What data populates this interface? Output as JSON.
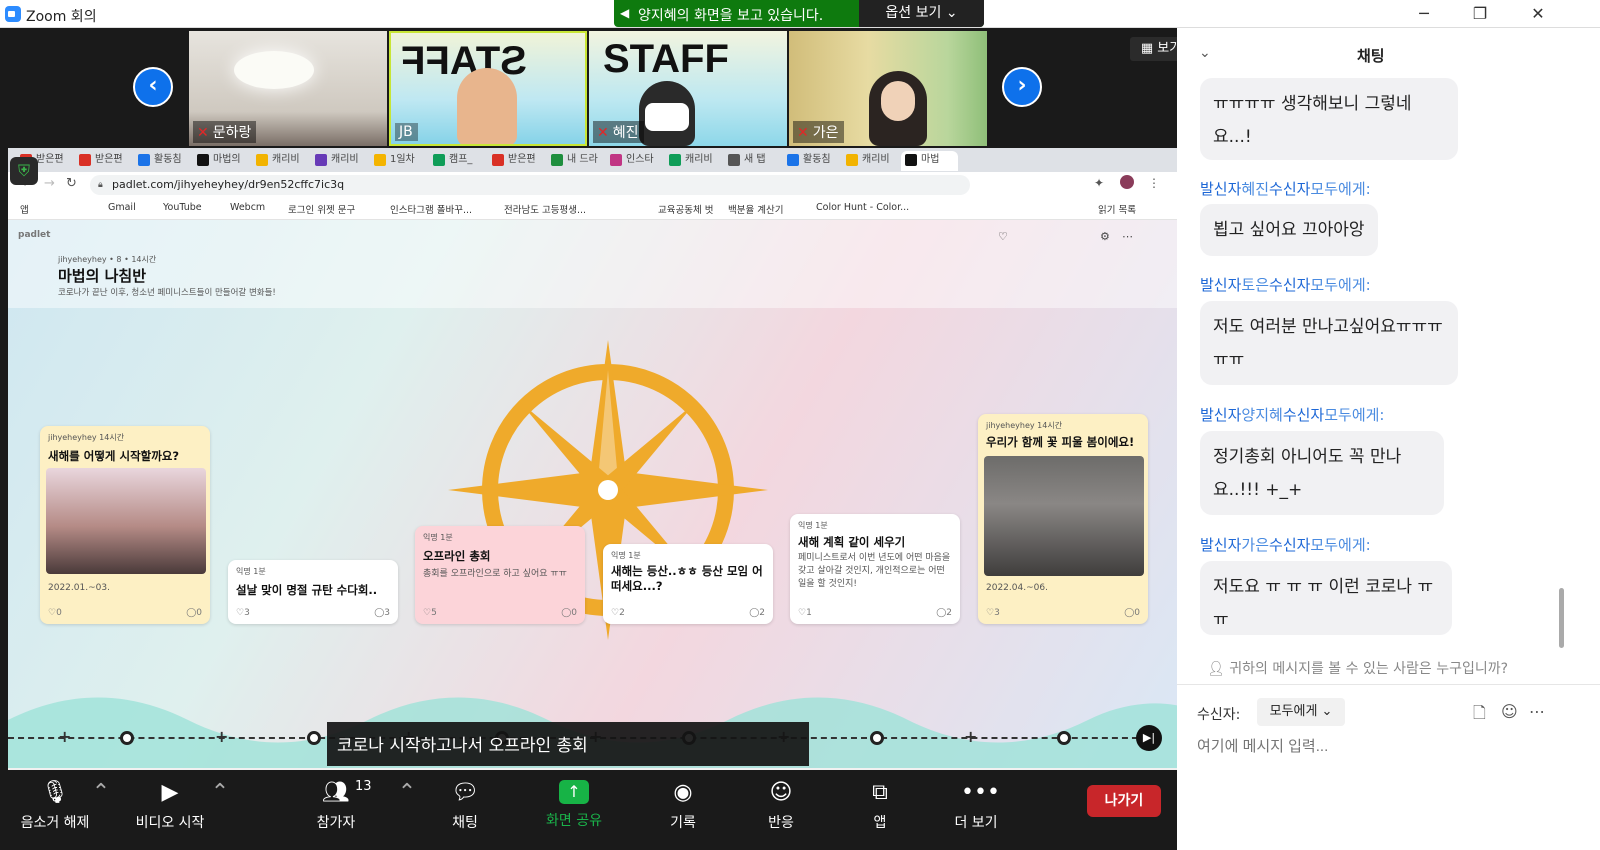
{
  "window": {
    "title": "Zoom 회의",
    "minimize": "─",
    "restore": "❐",
    "close": "✕"
  },
  "share_banner": {
    "text": "양지혜의 화면을 보고 있습니다.",
    "options": "옵션 보기 ⌄"
  },
  "view_button": "보기",
  "participants": [
    {
      "name": "문하랑",
      "muted": true
    },
    {
      "name": "JB",
      "muted": false
    },
    {
      "name": "혜진",
      "muted": true
    },
    {
      "name": "가은",
      "muted": true
    }
  ],
  "browser": {
    "tabs": [
      "받은편",
      "받은편",
      "활동침",
      "마법의",
      "캐리비",
      "캐리비",
      "1일차",
      "캠프_",
      "받은편",
      "내 드라",
      "인스타",
      "캐리비",
      "새 탭",
      "활동침",
      "캐리비",
      "마법"
    ],
    "url": "padlet.com/jihyeheyhey/dr9en52cffc7ic3q",
    "bookmarks": [
      "앱",
      "Gmail",
      "YouTube",
      "Webcm",
      "로그인 위젯 문구",
      "인스타그램 폴바꾸...",
      "전라남도 고등평생...",
      "교육공동체 벗",
      "백분율 계산기",
      "Color Hunt - Color...",
      "읽기 목록"
    ]
  },
  "padlet": {
    "brand": "padlet",
    "owner": "jihyeheyhey",
    "meta": "• 8 • 14시간",
    "title": "마법의 나침반",
    "subtitle": "코로나가 끝난 이후, 청소년 페미니스트들이 만들어갈 변화들!",
    "cards": [
      {
        "author": "jihyeheyhey",
        "time": "14시간",
        "title": "새해를 어떻게 시작할까요?",
        "body": "",
        "date": "2022.01.~03.",
        "likes": "0",
        "comments": "0"
      },
      {
        "author": "익명",
        "time": "1분",
        "title": "설날 맞이 명절 규탄 수다회..",
        "body": "",
        "date": "",
        "likes": "3",
        "comments": "3"
      },
      {
        "author": "익명",
        "time": "1분",
        "title": "오프라인 총회",
        "body": "총회를 오프라인으로 하고 싶어요 ㅠㅠ",
        "date": "",
        "likes": "5",
        "comments": "0"
      },
      {
        "author": "익명",
        "time": "1분",
        "title": "새해는 등산..ㅎㅎ 등산 모임 어떠세요...?",
        "body": "",
        "date": "",
        "likes": "2",
        "comments": "2"
      },
      {
        "author": "익명",
        "time": "1분",
        "title": "새해 계획 같이 세우기",
        "body": "페미니스트로서 이번 년도에 어떤 마음을 갖고 살아갈 것인지, 개인적으로는 어떤 일을 할 것인지!",
        "date": "",
        "likes": "1",
        "comments": "2"
      },
      {
        "author": "jihyeheyhey",
        "time": "14시간",
        "title": "우리가 함께 꽃 피울 봄이에요!",
        "body": "",
        "date": "2022.04.~06.",
        "likes": "3",
        "comments": "0"
      }
    ],
    "add_button": "+"
  },
  "caption": "코로나 시작하고나서 오프라인 총회",
  "toolbar": {
    "mute": "음소거 해제",
    "video": "비디오 시작",
    "participants": "참가자",
    "participants_count": "13",
    "chat": "채팅",
    "share": "화면 공유",
    "record": "기록",
    "reactions": "반응",
    "apps": "앱",
    "more": "더 보기",
    "leave": "나가기"
  },
  "chat": {
    "title": "채팅",
    "messages": [
      {
        "sender": "",
        "text": "ㅠㅠㅠㅠ 생각해보니 그렇네요...!"
      },
      {
        "sender": "혜진",
        "text": "뵙고 싶어요 끄아아앙"
      },
      {
        "sender": "토은",
        "text": "저도 여러분 만나고싶어요ㅠㅠㅠㅠㅠ"
      },
      {
        "sender": "양지혜",
        "text": "정기총회 아니어도 꼭 만나요..!!! +_+"
      },
      {
        "sender": "가은",
        "text": "저도요 ㅠ ㅠ ㅠ 이런 코로나 ㅠ ㅠ"
      }
    ],
    "sender_prefix": "발신자",
    "recipient_prefix": "수신자",
    "recipient_all": "모두에게:",
    "privacy": "귀하의 메시지를 볼 수 있는 사람은 누구입니까?",
    "recipient_label": "수신자:",
    "recipient_value": "모두에게 ⌄",
    "input_placeholder": "여기에 메시지 입력..."
  }
}
